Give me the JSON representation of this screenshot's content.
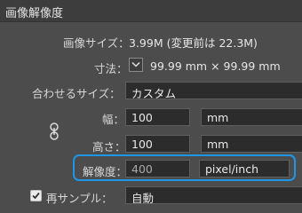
{
  "window": {
    "title": "画像解像度"
  },
  "image_size": {
    "label": "画像サイズ：",
    "value": "3.99M (変更前は 22.3M)"
  },
  "dimensions": {
    "label": "寸法：",
    "icon": "chevron-down-icon",
    "value": "99.99 mm × 99.99 mm"
  },
  "fit_to": {
    "label": "合わせるサイズ：",
    "value": "カスタム"
  },
  "width": {
    "label": "幅：",
    "value": "100",
    "unit": "mm"
  },
  "height": {
    "label": "高さ：",
    "value": "100",
    "unit": "mm"
  },
  "constrain": {
    "icon": "link-icon"
  },
  "resolution": {
    "label": "解像度：",
    "value": "400",
    "unit": "pixel/inch",
    "highlight_color": "#1e96e6"
  },
  "resample": {
    "checked": true,
    "label": "再サンプル：",
    "value": "自動"
  }
}
